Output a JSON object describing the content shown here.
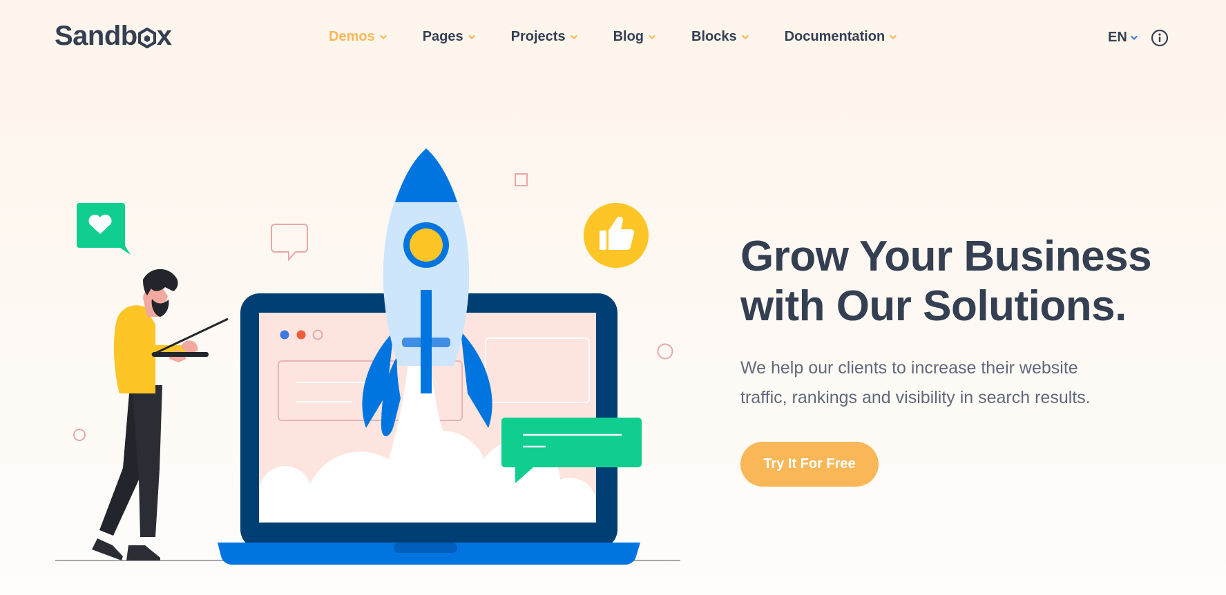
{
  "brand": {
    "logo_text_left": "Sandb",
    "logo_text_right": "x",
    "text_color": "#343f52",
    "accent_color": "#fab758"
  },
  "nav": {
    "items": [
      {
        "label": "Demos",
        "active": true
      },
      {
        "label": "Pages",
        "active": false
      },
      {
        "label": "Projects",
        "active": false
      },
      {
        "label": "Blog",
        "active": false
      },
      {
        "label": "Blocks",
        "active": false
      },
      {
        "label": "Documentation",
        "active": false
      }
    ],
    "language": "EN",
    "info_icon": "info-icon",
    "chevron_icon": "chevron-down-icon"
  },
  "hero": {
    "title_line1": "Grow Your Business",
    "title_line2": "with Our Solutions.",
    "text_line1": "We help our clients to increase their website",
    "text_line2": "traffic, rankings and visibility in search results.",
    "cta_label": "Try It For Free"
  },
  "illustration": {
    "icons": [
      "rocket-icon",
      "laptop-icon",
      "heart-icon",
      "thumbs-up-icon",
      "chat-bubble-icon",
      "person-icon"
    ],
    "colors": {
      "blue": "#0075e0",
      "dark_blue": "#003f73",
      "green": "#10ce8f",
      "yellow": "#fec527",
      "pink_screen": "#fde4df"
    }
  }
}
